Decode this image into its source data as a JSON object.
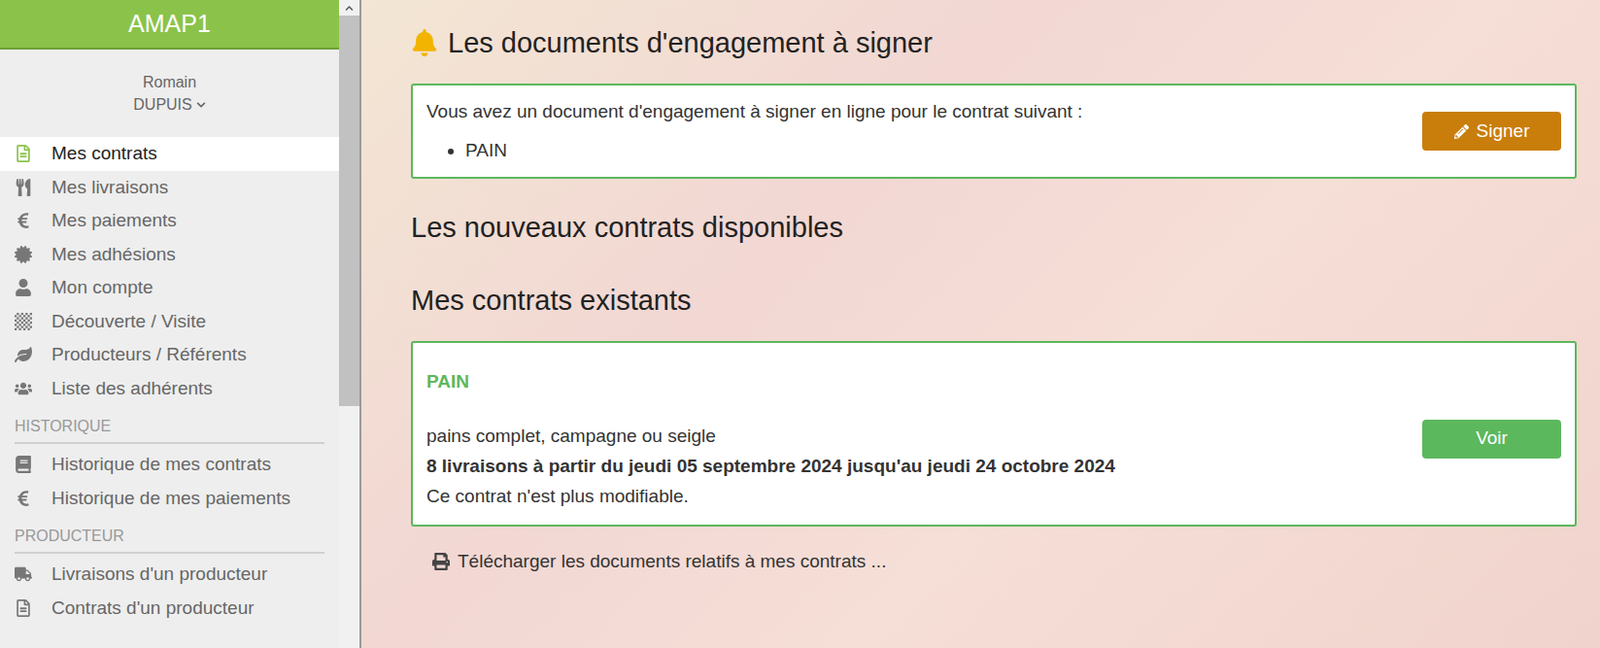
{
  "sidebar": {
    "title": "AMAP1",
    "user": {
      "first_name": "Romain",
      "last_name": "DUPUIS"
    },
    "items": [
      {
        "label": "Mes contrats",
        "selected": true
      },
      {
        "label": "Mes livraisons",
        "selected": false
      },
      {
        "label": "Mes paiements",
        "selected": false
      },
      {
        "label": "Mes adhésions",
        "selected": false
      },
      {
        "label": "Mon compte",
        "selected": false
      },
      {
        "label": "Découverte / Visite",
        "selected": false
      },
      {
        "label": "Producteurs / Référents",
        "selected": false
      },
      {
        "label": "Liste des adhérents",
        "selected": false
      }
    ],
    "sections": [
      {
        "title": "HISTORIQUE",
        "items": [
          {
            "label": "Historique de mes contrats",
            "selected": false
          },
          {
            "label": "Historique de mes paiements",
            "selected": false
          }
        ]
      },
      {
        "title": "PRODUCTEUR",
        "items": [
          {
            "label": "Livraisons d'un producteur",
            "selected": false
          },
          {
            "label": "Contrats d'un producteur",
            "selected": false
          }
        ]
      }
    ]
  },
  "to_sign": {
    "heading": "Les documents d'engagement à signer",
    "text": "Vous avez un document d'engagement à signer en ligne pour le contrat suivant :",
    "contracts": [
      "PAIN"
    ],
    "button": "Signer"
  },
  "new_contracts": {
    "heading": "Les nouveaux contrats disponibles"
  },
  "existing_contracts": {
    "heading": "Mes contrats existants",
    "items": [
      {
        "name": "PAIN",
        "description": "pains complet, campagne ou seigle",
        "deliveries": "8 livraisons à partir du jeudi 05 septembre 2024 jusqu'au jeudi 24 octobre 2024",
        "status": "Ce contrat n'est plus modifiable.",
        "button": "Voir"
      }
    ]
  },
  "download_link": "Télécharger les documents relatifs à mes contrats ..."
}
